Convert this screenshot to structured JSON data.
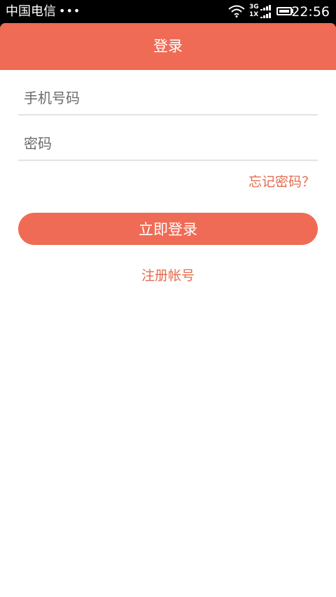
{
  "status_bar": {
    "carrier": "中国电信",
    "dots": "•••",
    "net_top": "3G",
    "net_bottom": "1X",
    "time": "22:56"
  },
  "header": {
    "title": "登录"
  },
  "form": {
    "phone_placeholder": "手机号码",
    "password_placeholder": "密码",
    "forgot_label": "忘记密码？",
    "login_label": "立即登录",
    "register_label": "注册帐号"
  },
  "colors": {
    "accent": "#ef6b55",
    "link": "#e56b4f"
  },
  "icons": [
    "wifi-icon",
    "signal-icon",
    "battery-icon"
  ]
}
